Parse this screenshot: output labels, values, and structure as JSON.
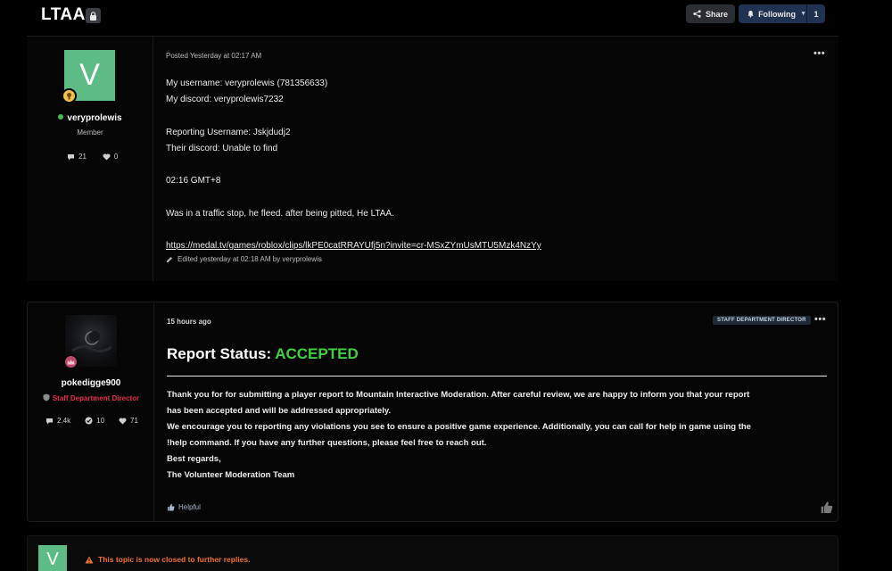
{
  "topic": {
    "title": "LTAA",
    "share_label": "Share",
    "following_label": "Following",
    "following_count": "1"
  },
  "post1": {
    "avatar_letter": "V",
    "username": "veryprolewis",
    "role": "Member",
    "stats": {
      "posts": "21",
      "likes": "0"
    },
    "posted": "Posted Yesterday at 02:17 AM",
    "lines": [
      "My username: veryprolewis (781356633)",
      "My discord: veryprolewis7232",
      "",
      "Reporting Username: Jskjdudj2",
      "Their discord: Unable to find",
      "",
      "02:16 GMT+8",
      "",
      "Was in a traffic stop, he fleed. after being pitted, He LTAA.",
      ""
    ],
    "link": "https://medal.tv/games/roblox/clips/lkPE0catRRAYUfj5n?invite=cr-MSxZYmUsMTU5Mzk4NzYy",
    "edited": "Edited yesterday at 02:18 AM by veryprolewis"
  },
  "post2": {
    "username": "pokedigge900",
    "role": "Staff Department Director",
    "stats": {
      "posts": "2.4k",
      "reputation": "10",
      "likes": "71"
    },
    "time": "15 hours ago",
    "tag": "STAFF DEPARTMENT DIRECTOR",
    "title_prefix": "Report Status: ",
    "title_status": "ACCEPTED",
    "status_color": "#3fd13f",
    "body_lines": [
      "Thank you for for submitting a player report to Mountain Interactive Moderation. After careful review, we are happy to inform you that your report",
      "has been accepted and will be addressed appropriately.",
      "We encourage you to reporting any violations you see to ensure a positive game experience. Additionally, you can call for help in game using the",
      "!help command. If you have any further questions, please feel free to reach out.",
      "Best regards,",
      "The Volunteer Moderation Team"
    ],
    "helpful_label": "Helpful"
  },
  "closed_notice": {
    "avatar_letter": "V",
    "text": "This topic is now closed to further replies."
  },
  "colors": {
    "accent_green": "#5dbc86",
    "warning_orange": "#f0732c",
    "staff_red": "#e0324a"
  }
}
